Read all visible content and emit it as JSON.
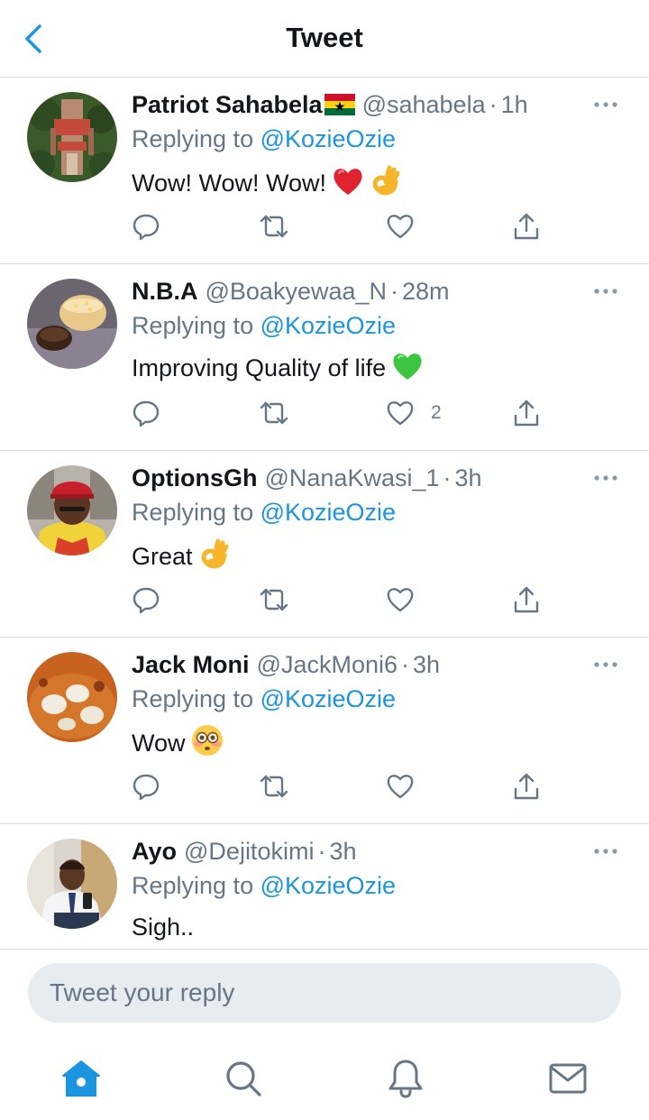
{
  "header": {
    "title": "Tweet",
    "back_icon": "chevron-left-icon"
  },
  "colors": {
    "accent": "#1b95e0",
    "secondary_text": "#657786",
    "primary_text": "#14171a",
    "divider": "#d5dbe0",
    "input_bg": "#e6ecf0"
  },
  "tweets": [
    {
      "name": "Patriot Sahabela",
      "name_emoji": "ghana-flag",
      "handle": "@sahabela",
      "separator": "·",
      "time": "1h",
      "replying_prefix": "Replying to",
      "replying_to": "@KozieOzie",
      "text": "Wow! Wow! Wow!",
      "emojis": [
        "red-heart",
        "ok-hand"
      ],
      "like_count": ""
    },
    {
      "name": "N.B.A",
      "name_emoji": "",
      "handle": "@Boakyewaa_N",
      "separator": "·",
      "time": "28m",
      "replying_prefix": "Replying to",
      "replying_to": "@KozieOzie",
      "text": "Improving Quality of life",
      "emojis": [
        "green-heart"
      ],
      "like_count": "2"
    },
    {
      "name": "OptionsGh",
      "name_emoji": "",
      "handle": "@NanaKwasi_1",
      "separator": "·",
      "time": "3h",
      "replying_prefix": "Replying to",
      "replying_to": "@KozieOzie",
      "text": "Great",
      "emojis": [
        "ok-hand"
      ],
      "like_count": ""
    },
    {
      "name": "Jack Moni",
      "name_emoji": "",
      "handle": "@JackMoni6",
      "separator": "·",
      "time": "3h",
      "replying_prefix": "Replying to",
      "replying_to": "@KozieOzie",
      "text": "Wow",
      "emojis": [
        "flushed-face"
      ],
      "like_count": ""
    },
    {
      "name": "Ayo",
      "name_emoji": "",
      "handle": "@Dejitokimi",
      "separator": "·",
      "time": "3h",
      "replying_prefix": "Replying to",
      "replying_to": "@KozieOzie",
      "text": "Sigh..",
      "emojis": [],
      "like_count": ""
    }
  ],
  "reply_bar": {
    "placeholder": "Tweet your reply"
  },
  "tabbar": {
    "items": [
      "home-icon",
      "search-icon",
      "bell-icon",
      "mail-icon"
    ],
    "active": "home-icon"
  }
}
